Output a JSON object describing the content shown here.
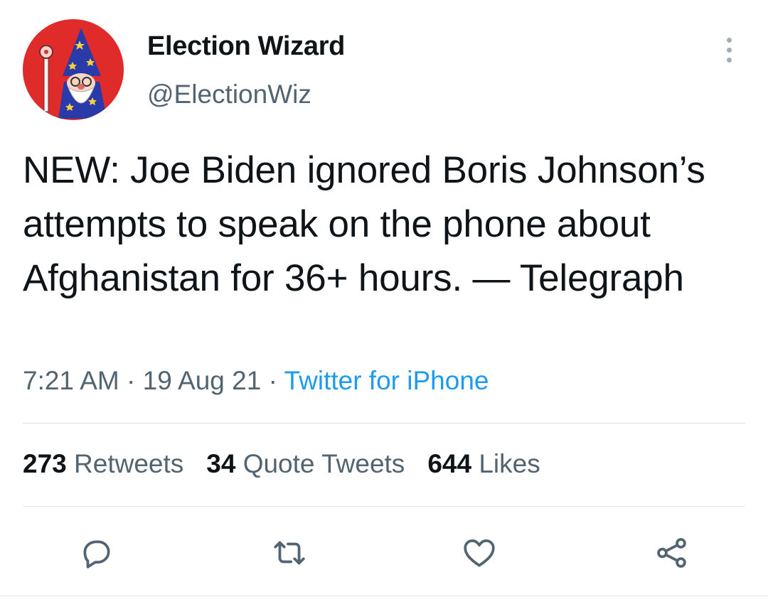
{
  "author": {
    "display_name": "Election Wizard",
    "handle": "@ElectionWiz",
    "avatar": "wizard-avatar"
  },
  "tweet": {
    "text": "NEW: Joe Biden ignored Boris Johnson’s attempts to speak on the phone about Afghanistan for 36+ hours. — Telegraph",
    "time": "7:21 AM",
    "date": "19 Aug 21",
    "separator": "·",
    "source": "Twitter for iPhone"
  },
  "stats": {
    "retweets_count": "273",
    "retweets_label": "Retweets",
    "quotes_count": "34",
    "quotes_label": "Quote Tweets",
    "likes_count": "644",
    "likes_label": "Likes"
  },
  "icons": {
    "more": "more-options-icon",
    "reply": "reply-icon",
    "retweet": "retweet-icon",
    "like": "heart-icon",
    "share": "share-icon"
  },
  "colors": {
    "link": "#1d9bf0",
    "secondary_text": "#536471",
    "primary_text": "#0f1419",
    "avatar_bg": "#e02b2b"
  }
}
